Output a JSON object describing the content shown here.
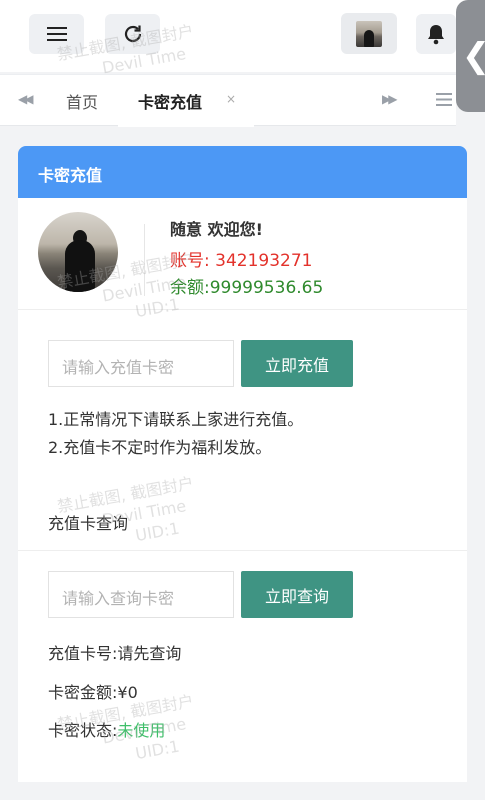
{
  "topbar": {
    "menu_icon": "hamburger-icon",
    "refresh_icon": "refresh-icon",
    "bell_icon": "bell-icon",
    "side_toggle": "❮"
  },
  "tabs": {
    "home": "首页",
    "active": "卡密充值",
    "close": "×"
  },
  "card": {
    "title": "卡密充值"
  },
  "profile": {
    "welcome": "随意 欢迎您!",
    "account": "账号: 342193271",
    "balance": "余额:99999536.65"
  },
  "recharge": {
    "placeholder": "请输入充值卡密",
    "button": "立即充值",
    "note1": "1.正常情况下请联系上家进行充值。",
    "note2": "2.充值卡不定时作为福利发放。"
  },
  "query": {
    "heading": "充值卡查询",
    "placeholder": "请输入查询卡密",
    "button": "立即查询",
    "card_no": "充值卡号:请先查询",
    "amount": "卡密金额:¥0",
    "status_label": "卡密状态:",
    "status_value": "未使用"
  },
  "watermark": {
    "line1": "禁止截图, 截图封户",
    "line2": "Devil Time",
    "line3": "UID:1"
  },
  "colors": {
    "header_blue": "#4c98f5",
    "button_green": "#3f9483",
    "account_red": "#e3322b",
    "balance_green": "#2f8a2d",
    "status_green": "#3fbf6a"
  }
}
